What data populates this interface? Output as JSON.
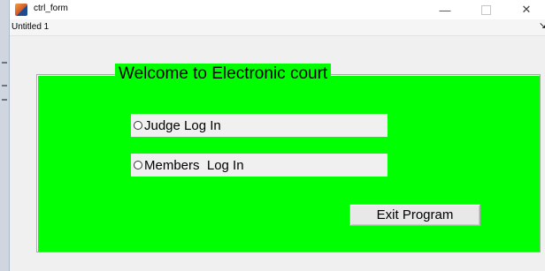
{
  "window": {
    "title": "ctrl_form",
    "minimize_glyph": "—",
    "close_glyph": "✕"
  },
  "menubar": {
    "item": "Untitled 1",
    "arrow": "↘"
  },
  "panel": {
    "title": "Welcome to Electronic court",
    "background_color": "#00ff00"
  },
  "options": [
    {
      "label": "Judge Log In"
    },
    {
      "label": "Members  Log In"
    }
  ],
  "exit_button": {
    "label": "Exit Program"
  }
}
